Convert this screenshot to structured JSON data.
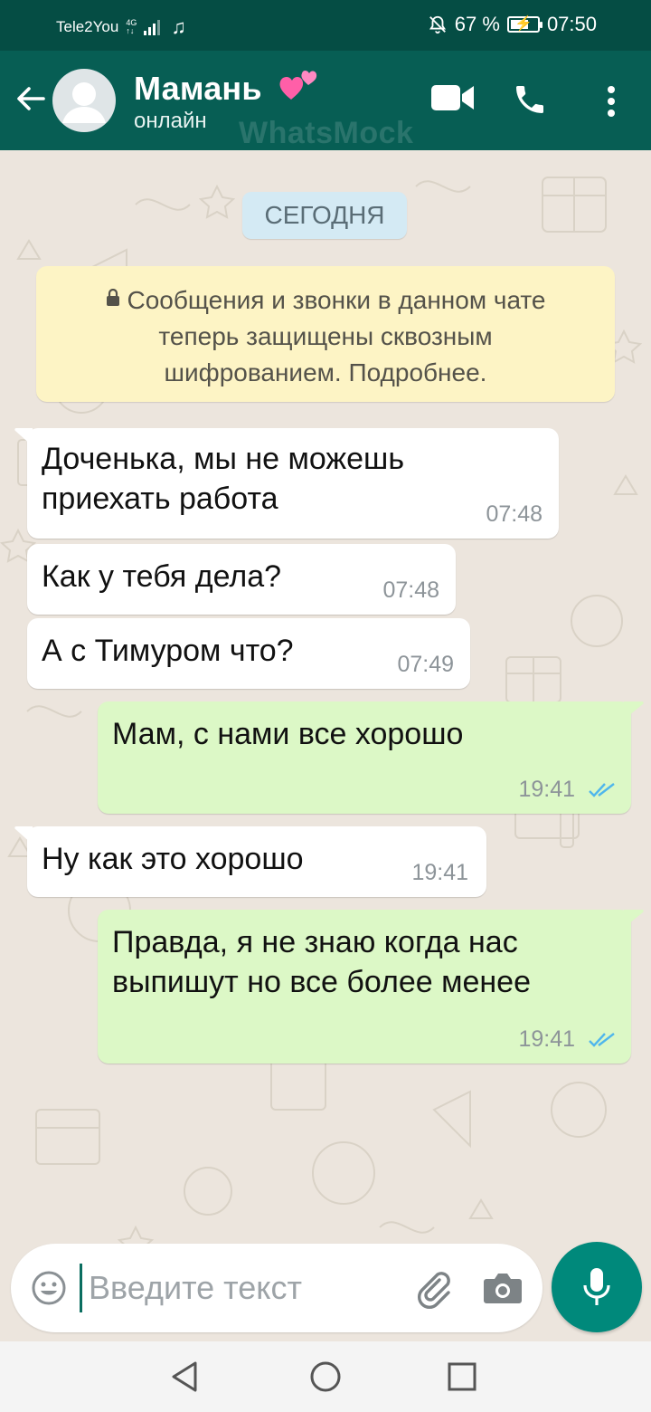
{
  "status_bar": {
    "carrier": "Tele2You",
    "network": "4G",
    "battery_percent": "67 %",
    "battery_level": 0.67,
    "time": "07:50",
    "icons": [
      "signal-icon",
      "music-note-icon",
      "mute-icon",
      "battery-icon"
    ]
  },
  "header": {
    "contact_name": "Мамань",
    "contact_emoji": "two-hearts-icon",
    "status": "онлайн",
    "watermark": "WhatsMock",
    "icons": [
      "back-arrow-icon",
      "avatar-placeholder",
      "video-call-icon",
      "phone-call-icon",
      "more-menu-icon"
    ]
  },
  "chat": {
    "date_label": "СЕГОДНЯ",
    "encryption_notice": "Сообщения и звонки в данном чате теперь защищены сквозным шифрованием. Подробнее.",
    "messages": [
      {
        "direction": "in",
        "lines": [
          "Доченька, мы не можешь",
          "приехать работа"
        ],
        "time": "07:48"
      },
      {
        "direction": "in",
        "lines": [
          "Как у тебя дела?"
        ],
        "time": "07:48"
      },
      {
        "direction": "in",
        "lines": [
          "А с Тимуром что?"
        ],
        "time": "07:49"
      },
      {
        "direction": "out",
        "lines": [
          "Мам, с нами все хорошо"
        ],
        "time": "19:41",
        "status": "read"
      },
      {
        "direction": "in",
        "lines": [
          "Ну как это хорошо"
        ],
        "time": "19:41"
      },
      {
        "direction": "out",
        "lines": [
          "Правда, я не знаю когда нас",
          "выпишут но все более менее"
        ],
        "time": "19:41",
        "status": "read"
      }
    ]
  },
  "input_bar": {
    "placeholder": "Введите текст",
    "value": "",
    "icons": [
      "emoji-icon",
      "attach-icon",
      "camera-icon",
      "mic-icon"
    ]
  },
  "nav_bar": {
    "icons": [
      "nav-back-icon",
      "nav-home-icon",
      "nav-recents-icon"
    ]
  },
  "colors": {
    "header": "#075e54",
    "status_bar": "#054d44",
    "chat_background": "#ece5dd",
    "incoming_bubble": "#ffffff",
    "outgoing_bubble": "#dcf8c6",
    "read_ticks": "#4fb6ec",
    "mic_button": "#00897b"
  }
}
